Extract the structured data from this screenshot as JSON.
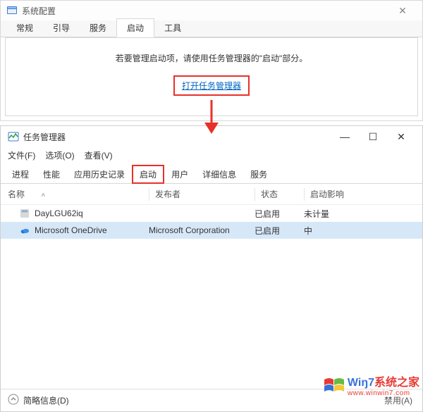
{
  "msconfig": {
    "title": "系统配置",
    "tabs": [
      "常规",
      "引导",
      "服务",
      "启动",
      "工具"
    ],
    "active_tab_index": 3,
    "hint": "若要管理启动项，请使用任务管理器的\"启动\"部分。",
    "link_label": "打开任务管理器"
  },
  "taskmgr": {
    "title": "任务管理器",
    "menus": [
      "文件(F)",
      "选项(O)",
      "查看(V)"
    ],
    "tabs": [
      "进程",
      "性能",
      "应用历史记录",
      "启动",
      "用户",
      "详细信息",
      "服务"
    ],
    "active_tab_index": 3,
    "columns": {
      "name": "名称",
      "publisher": "发布者",
      "status": "状态",
      "impact": "启动影响"
    },
    "rows": [
      {
        "icon": "app-generic-icon",
        "name": "DayLGU62iq",
        "publisher": "",
        "status": "已启用",
        "impact": "未计量",
        "selected": false
      },
      {
        "icon": "onedrive-icon",
        "name": "Microsoft OneDrive",
        "publisher": "Microsoft Corporation",
        "status": "已启用",
        "impact": "中",
        "selected": true
      }
    ],
    "statusbar": {
      "expand_label": "简略信息(D)",
      "disable_label": "禁用(A)"
    }
  },
  "watermark": {
    "line1a": "Wiŋ7",
    "line1b": "系统之家",
    "line2": "www.winwin7.com"
  }
}
